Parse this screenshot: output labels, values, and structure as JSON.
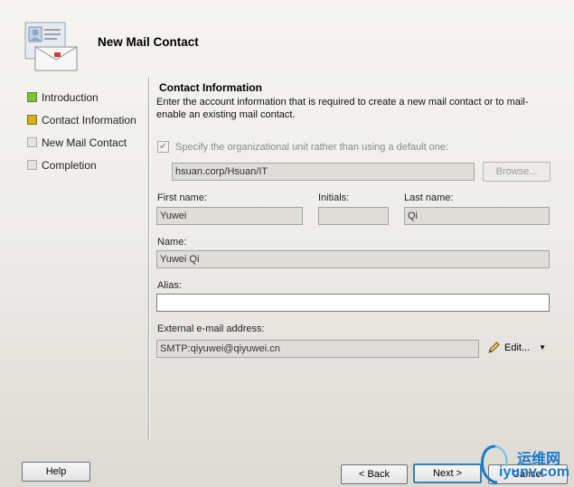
{
  "header": {
    "title": "New Mail Contact",
    "icon": "mail-contact-icon"
  },
  "steps": [
    {
      "label": "Introduction",
      "state": "completed"
    },
    {
      "label": "Contact Information",
      "state": "current"
    },
    {
      "label": "New Mail Contact",
      "state": "pending"
    },
    {
      "label": "Completion",
      "state": "pending"
    }
  ],
  "section": {
    "title": "Contact Information",
    "description": "Enter the account information that is required to create a new mail contact or to mail-enable an existing mail contact."
  },
  "ou": {
    "checkbox_label": "Specify the organizational unit rather than using a default one:",
    "checked": true,
    "value": "hsuan.corp/Hsuan/IT",
    "browse_label": "Browse..."
  },
  "fields": {
    "first_name_label": "First name:",
    "first_name": "Yuwei",
    "initials_label": "Initials:",
    "initials": "",
    "last_name_label": "Last name:",
    "last_name": "Qi",
    "name_label": "Name:",
    "name": "Yuwei Qi",
    "alias_label": "Alias:",
    "alias": "",
    "email_label": "External e-mail address:",
    "email": "SMTP:qiyuwei@qiyuwei.cn",
    "edit_label": "Edit..."
  },
  "buttons": {
    "help": "Help",
    "back": "< Back",
    "next": "Next >",
    "cancel": "Cancel"
  },
  "watermark": {
    "cn": "运维网",
    "url": "iyunv.com"
  },
  "colors": {
    "step_done": "#7fbf3f",
    "step_current": "#d4b020",
    "step_pending": "#e3e3e3",
    "default_button_border": "#3c7fb1",
    "watermark": "#1a79c9"
  }
}
